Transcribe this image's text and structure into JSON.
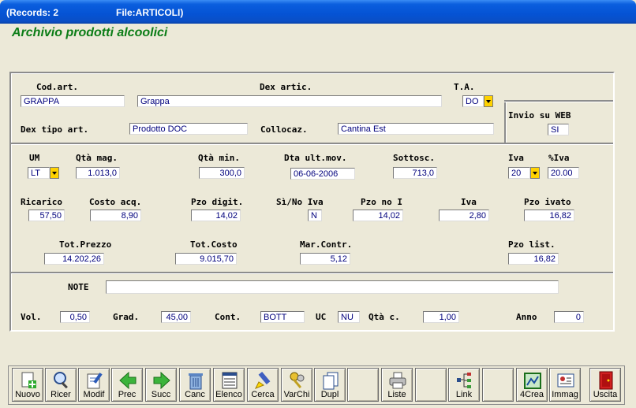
{
  "titlebar": {
    "records": "(Records: 2",
    "file": "File:ARTICOLI)"
  },
  "app_title": "Archivio prodotti alcoolici",
  "labels": {
    "cod_art": "Cod.art.",
    "dex_artic": "Dex artic.",
    "ta": "T.A.",
    "invio_web": "Invio su WEB",
    "dex_tipo": "Dex tipo art.",
    "collocaz": "Collocaz.",
    "um": "UM",
    "qta_mag": "Qtà mag.",
    "qta_min": "Qtà min.",
    "dta_ult_mov": "Dta ult.mov.",
    "sottosc": "Sottosc.",
    "iva": "Iva",
    "perc_iva": "%Iva",
    "ricarico": "Ricarico",
    "costo_acq": "Costo acq.",
    "pzo_digit": "Pzo digit.",
    "si_no_iva": "Sì/No Iva",
    "pzo_no_i": "Pzo no I",
    "iva2": "Iva",
    "pzo_ivato": "Pzo ivato",
    "tot_prezzo": "Tot.Prezzo",
    "tot_costo": "Tot.Costo",
    "mar_contr": "Mar.Contr.",
    "pzo_list": "Pzo list.",
    "note": "NOTE",
    "vol": "Vol.",
    "grad": "Grad.",
    "cont": "Cont.",
    "uc": "UC",
    "qta_c": "Qtà c.",
    "anno": "Anno"
  },
  "values": {
    "cod_art": "GRAPPA",
    "dex_artic": "Grappa",
    "ta": "DO",
    "invio_web": "SI",
    "dex_tipo": "Prodotto DOC",
    "collocaz": "Cantina Est",
    "um": "LT",
    "qta_mag": "1.013,0",
    "qta_min": "300,0",
    "dta_ult_mov": "06-06-2006",
    "sottosc": "713,0",
    "iva": "20",
    "perc_iva": "20.00",
    "ricarico": "57,50",
    "costo_acq": "8,90",
    "pzo_digit": "14,02",
    "si_no_iva": "N",
    "pzo_no_i": "14,02",
    "iva2": "2,80",
    "pzo_ivato": "16,82",
    "tot_prezzo": "14.202,26",
    "tot_costo": "9.015,70",
    "mar_contr": "5,12",
    "pzo_list": "16,82",
    "note": "",
    "vol": "0,50",
    "grad": "45,00",
    "cont": "BOTT",
    "uc": "NU",
    "qta_c": "1,00",
    "anno": "0"
  },
  "toolbar": {
    "nuovo": "Nuovo",
    "ricer": "Ricer",
    "modif": "Modif",
    "prec": "Prec",
    "succ": "Succ",
    "canc": "Canc",
    "elenco": "Elenco",
    "cerca": "Cerca",
    "varchi": "VarChi",
    "dupl": "Dupl",
    "liste": "Liste",
    "link": "Link",
    "crea": "4Crea",
    "immag": "Immag",
    "uscita": "Uscita"
  },
  "icons": [
    "new-doc-icon",
    "search-magnifier-icon",
    "edit-doc-icon",
    "arrow-left-icon",
    "arrow-right-icon",
    "trash-icon",
    "list-icon",
    "find-highlighter-icon",
    "keys-icon",
    "duplicate-icon",
    "printer-icon",
    "tree-link-icon",
    "create-frame-icon",
    "image-card-icon",
    "exit-door-icon"
  ],
  "colors": {
    "title_green": "#0c7d17",
    "field_text": "#00007d",
    "dropdown": "#ffd200",
    "titlebar": "#0553d4"
  }
}
